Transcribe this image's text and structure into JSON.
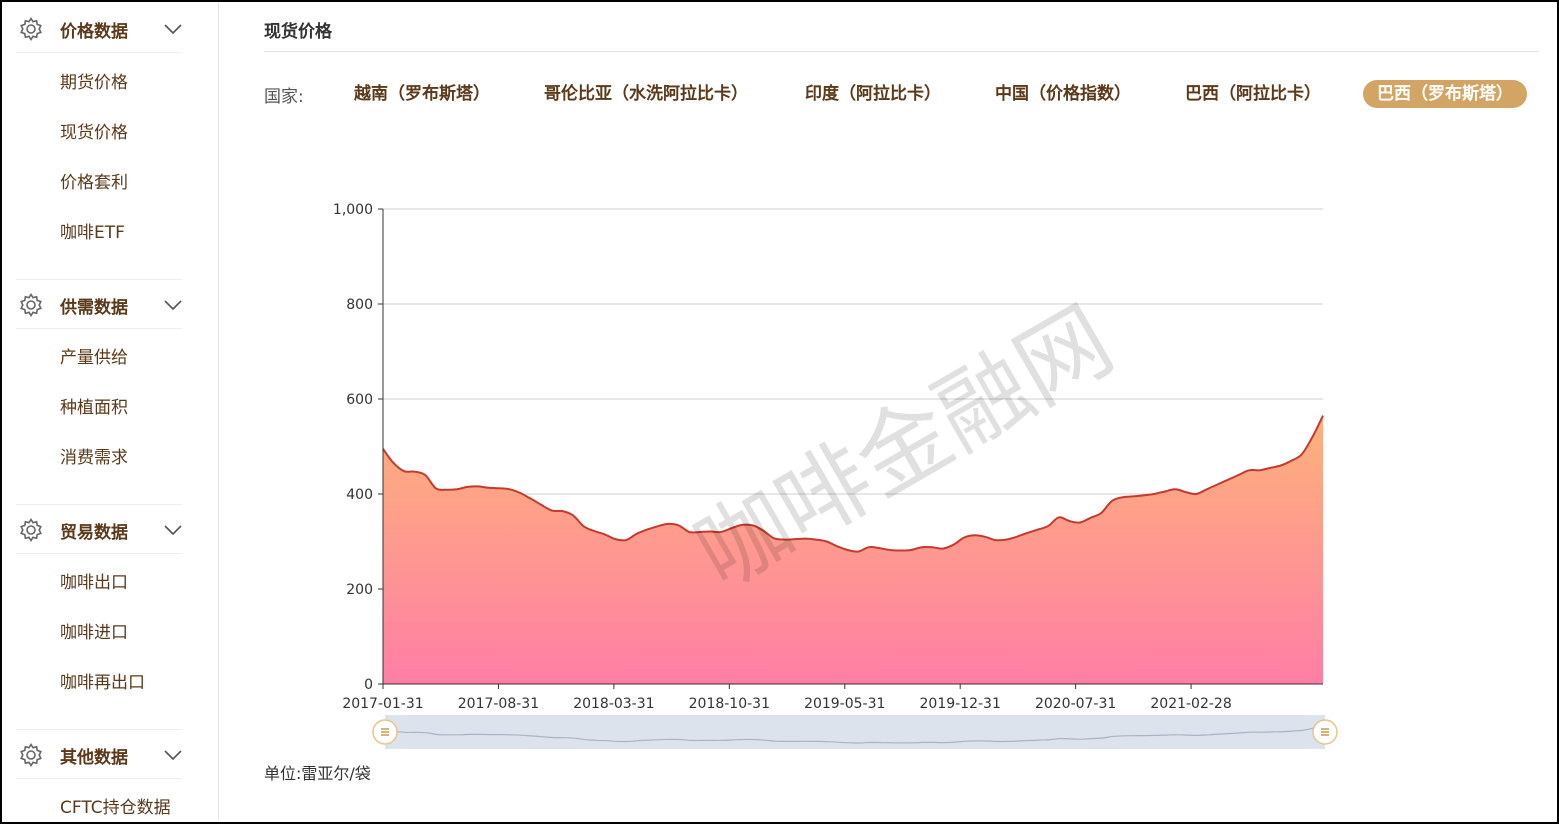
{
  "sidebar": {
    "groups": [
      {
        "title": "价格数据",
        "items": [
          "期货价格",
          "现货价格",
          "价格套利",
          "咖啡ETF"
        ]
      },
      {
        "title": "供需数据",
        "items": [
          "产量供给",
          "种植面积",
          "消费需求"
        ]
      },
      {
        "title": "贸易数据",
        "items": [
          "咖啡出口",
          "咖啡进口",
          "咖啡再出口"
        ]
      },
      {
        "title": "其他数据",
        "items": [
          "CFTC持仓数据"
        ]
      }
    ]
  },
  "main": {
    "title": "现货价格",
    "country_label": "国家:",
    "tabs": [
      {
        "label": "越南（罗布斯塔）",
        "active": false
      },
      {
        "label": "哥伦比亚（水洗阿拉比卡）",
        "active": false
      },
      {
        "label": "印度（阿拉比卡）",
        "active": false
      },
      {
        "label": "中国（价格指数）",
        "active": false
      },
      {
        "label": "巴西（阿拉比卡）",
        "active": false
      },
      {
        "label": "巴西（罗布斯塔）",
        "active": true
      }
    ],
    "unit_label": "单位:",
    "unit_value": "雷亚尔/袋",
    "watermark": "咖啡金融网"
  },
  "colors": {
    "accent": "#d3a565",
    "line": "#c23b2e",
    "area_top": "#fdb27a",
    "area_bottom": "#ff7ea6"
  },
  "chart_data": {
    "type": "area",
    "ylim": [
      0,
      1000
    ],
    "yticks": [
      "0",
      "200",
      "400",
      "600",
      "800",
      "1,000"
    ],
    "xticks": [
      "2017-01-31",
      "2017-08-31",
      "2018-03-31",
      "2018-10-31",
      "2019-05-31",
      "2019-12-31",
      "2020-07-31",
      "2021-02-28"
    ],
    "x_start": "2017-01-31",
    "x_end": "2021-10-31",
    "series": [
      {
        "values": [
          495,
          465,
          448,
          447,
          440,
          412,
          409,
          410,
          415,
          416,
          413,
          412,
          410,
          402,
          390,
          377,
          365,
          364,
          355,
          332,
          322,
          315,
          305,
          303,
          316,
          325,
          332,
          337,
          334,
          320,
          320,
          321,
          320,
          328,
          335,
          334,
          323,
          307,
          304,
          305,
          306,
          304,
          300,
          290,
          282,
          279,
          288,
          286,
          282,
          281,
          282,
          288,
          288,
          285,
          293,
          308,
          313,
          310,
          303,
          304,
          310,
          318,
          325,
          333,
          351,
          343,
          340,
          350,
          360,
          385,
          393,
          395,
          397,
          400,
          405,
          410,
          404,
          400,
          410,
          420,
          430,
          440,
          450,
          450,
          455,
          460,
          470,
          484,
          520,
          565
        ]
      }
    ]
  }
}
